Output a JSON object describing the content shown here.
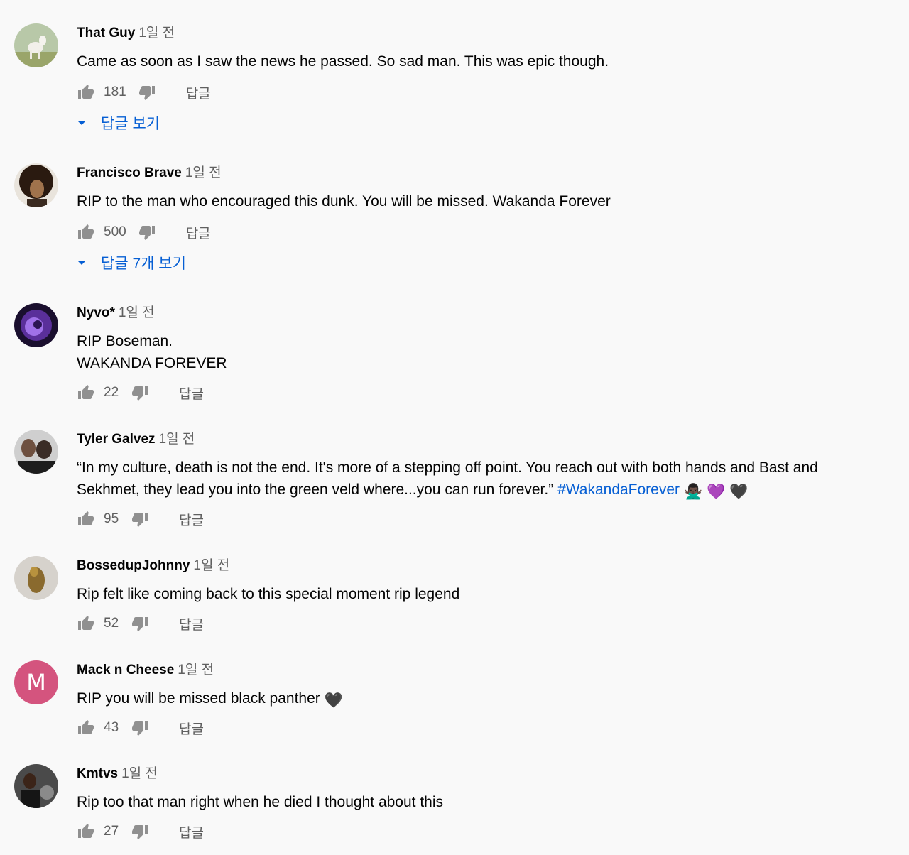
{
  "comments": [
    {
      "author": "That Guy",
      "time": "1일 전",
      "text": "Came as soon as I saw the news he passed. So sad man. This was epic though.",
      "likes": "181",
      "reply_label": "답글",
      "view_replies": "답글 보기",
      "avatar": "goat-avatar"
    },
    {
      "author": "Francisco Brave",
      "time": "1일 전",
      "text": "RIP to the man who encouraged this dunk. You will be missed. Wakanda Forever",
      "likes": "500",
      "reply_label": "답글",
      "view_replies": "답글 7개 보기",
      "avatar": "silhouette-avatar"
    },
    {
      "author": "Nyvo*",
      "time": "1일 전",
      "text": "RIP Boseman.\nWAKANDA FOREVER",
      "likes": "22",
      "reply_label": "답글",
      "avatar": "purple-orb-avatar"
    },
    {
      "author": "Tyler Galvez",
      "time": "1일 전",
      "text": "“In my culture, death is not the end. It's more of a stepping off point. You reach out with both hands and Bast and Sekhmet, they lead you into the green veld where...you can run forever.” ",
      "hashtag": "#WakandaForever",
      "emojis": "🙅🏿‍♂️ 💜 🖤",
      "likes": "95",
      "reply_label": "답글",
      "avatar": "photo-avatar"
    },
    {
      "author": "BossedupJohnny",
      "time": "1일 전",
      "text": "Rip felt like coming back to this special moment rip legend",
      "likes": "52",
      "reply_label": "답글",
      "avatar": "gold-figure-avatar"
    },
    {
      "author": "Mack n Cheese",
      "time": "1일 전",
      "text": "RIP you will be missed black panther",
      "emojis": "🖤",
      "likes": "43",
      "reply_label": "답글",
      "avatar_letter": "M",
      "avatar_color": "#d4547e"
    },
    {
      "author": "Kmtvs",
      "time": "1일 전",
      "text": "Rip too that man right when he died I thought about this",
      "likes": "27",
      "reply_label": "답글",
      "avatar": "person-car-avatar"
    }
  ],
  "colors": {
    "background": "#f9f9f9",
    "link": "#065fd4",
    "secondary_text": "#606060",
    "icon": "#909090"
  }
}
